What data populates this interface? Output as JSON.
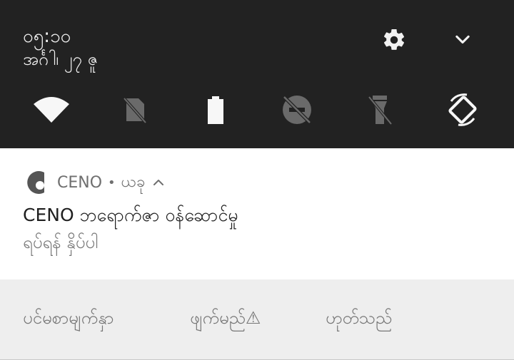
{
  "status": {
    "time": "၀၅:၁၀",
    "date": "အင်္ဂါ၊ ၂၇ ဇူ"
  },
  "colors": {
    "shade_bg": "#222222",
    "card_bg": "#ffffff",
    "actions_bg": "#eeeeee",
    "text_secondary": "#6f6f6f"
  },
  "header_icons": [
    "gear-icon",
    "chevron-down-icon"
  ],
  "quick_tiles": [
    "wifi-icon",
    "sim-off-icon",
    "battery-icon",
    "do-not-disturb-off-icon",
    "flashlight-off-icon",
    "auto-rotate-icon"
  ],
  "notification": {
    "app_name": "CENO",
    "separator": "•",
    "when": "ယခု",
    "title": "CENO ဘရောက်ဇာ ဝန်ဆောင်မှု",
    "subtitle": "ရပ်ရန် နှိပ်ပါ",
    "actions": [
      "ပင်မစာမျက်နှာ",
      "ဖျက်မည်⚠",
      "ဟုတ်သည်"
    ]
  }
}
